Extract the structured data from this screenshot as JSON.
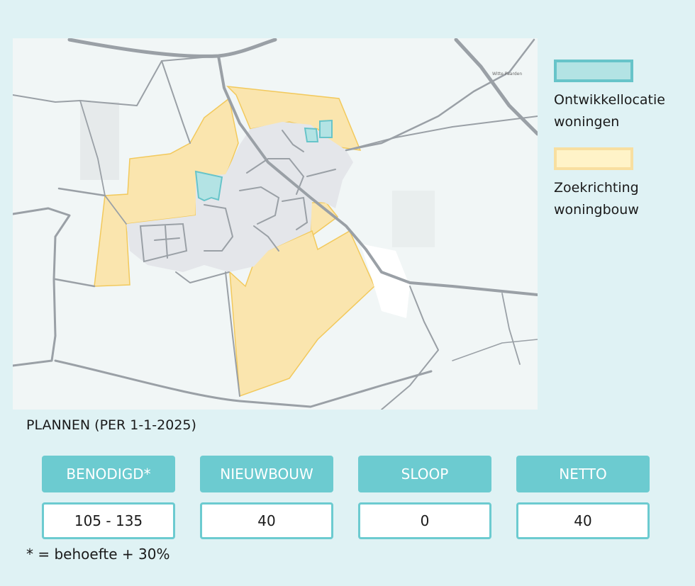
{
  "legend": {
    "items": [
      {
        "key": "dev",
        "label": "Ontwikkellocatie\nwoningen"
      },
      {
        "key": "search",
        "label": "Zoekrichting\nwoningbouw"
      }
    ]
  },
  "map": {
    "place_label": "Witte Paarden",
    "colors": {
      "development_fill": "#b3e3e4",
      "development_stroke": "#67c4c9",
      "search_fill": "#fbe3a6",
      "search_stroke": "#f2c95c",
      "built_area": "#e4e6ea",
      "roads": "#9aa0a6"
    }
  },
  "plans": {
    "title": "PLANNEN (PER 1-1-2025)",
    "columns": [
      {
        "header": "BENODIGD*",
        "value": "105 - 135"
      },
      {
        "header": "NIEUWBOUW",
        "value": "40"
      },
      {
        "header": "SLOOP",
        "value": "0"
      },
      {
        "header": "NETTO",
        "value": "40"
      }
    ],
    "footnote": "* = behoefte + 30%"
  }
}
